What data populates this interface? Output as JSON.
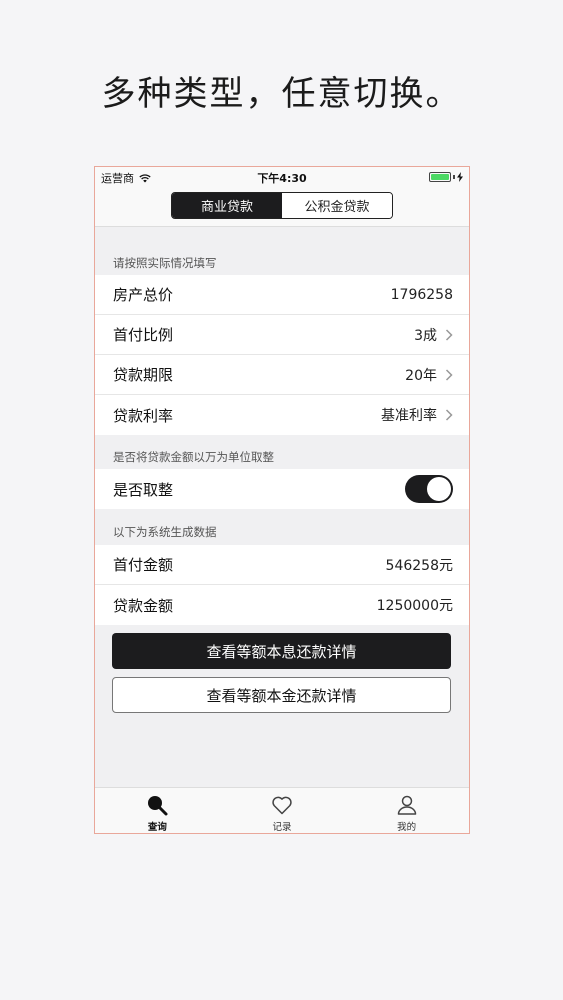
{
  "headline": "多种类型，任意切换。",
  "status_bar": {
    "carrier": "运营商",
    "time": "下午4:30"
  },
  "segmented": {
    "commercial": "商业贷款",
    "provident": "公积金贷款"
  },
  "section1": {
    "header": "请按照实际情况填写",
    "rows": [
      {
        "label": "房产总价",
        "value": "1796258"
      },
      {
        "label": "首付比例",
        "value": "3成"
      },
      {
        "label": "贷款期限",
        "value": "20年"
      },
      {
        "label": "贷款利率",
        "value": "基准利率"
      }
    ]
  },
  "section2": {
    "header": "是否将贷款金额以万为单位取整",
    "toggle_label": "是否取整",
    "toggle_on": true
  },
  "section3": {
    "header": "以下为系统生成数据",
    "rows": [
      {
        "label": "首付金额",
        "value": "546258元"
      },
      {
        "label": "贷款金额",
        "value": "1250000元"
      }
    ]
  },
  "buttons": {
    "equal_interest": "查看等额本息还款详情",
    "equal_principal": "查看等额本金还款详情"
  },
  "tabs": [
    {
      "label": "查询",
      "icon": "search-icon"
    },
    {
      "label": "记录",
      "icon": "heart-icon"
    },
    {
      "label": "我的",
      "icon": "person-icon"
    }
  ],
  "colors": {
    "accent": "#1c1c1e",
    "battery": "#4cd964",
    "frame": "#e9a79a"
  }
}
